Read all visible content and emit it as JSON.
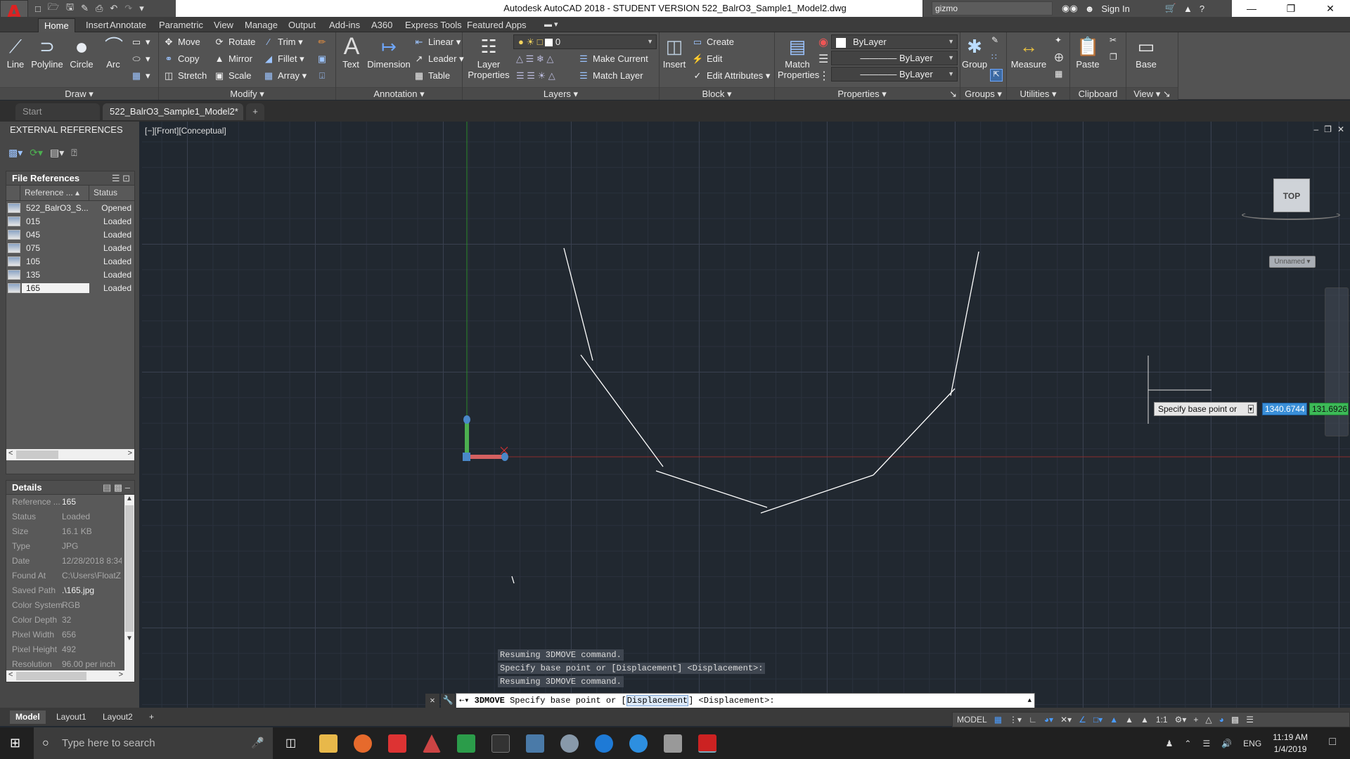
{
  "titlebar": {
    "app_icon": "autocad-logo-icon",
    "app_letter": "A",
    "title": "Autodesk AutoCAD 2018 - STUDENT VERSION    522_BalrO3_Sample1_Model2.dwg",
    "search_value": "gizmo",
    "sign_in": "Sign In",
    "quick_access": [
      "new-icon",
      "open-icon",
      "save-icon",
      "saveas-icon",
      "print-icon",
      "undo-icon",
      "redo-icon",
      "customize-icon"
    ]
  },
  "ribbon_tabs": [
    "Home",
    "Insert",
    "Annotate",
    "Parametric",
    "View",
    "Manage",
    "Output",
    "Add-ins",
    "A360",
    "Express Tools",
    "Featured Apps"
  ],
  "ribbon": {
    "draw": {
      "title": "Draw",
      "line": "Line",
      "polyline": "Polyline",
      "circle": "Circle",
      "arc": "Arc"
    },
    "modify": {
      "title": "Modify",
      "move": "Move",
      "rotate": "Rotate",
      "trim": "Trim",
      "copy": "Copy",
      "mirror": "Mirror",
      "fillet": "Fillet",
      "stretch": "Stretch",
      "scale": "Scale",
      "array": "Array"
    },
    "annotation": {
      "title": "Annotation",
      "text": "Text",
      "dimension": "Dimension",
      "linear": "Linear",
      "leader": "Leader",
      "table": "Table"
    },
    "layers": {
      "title": "Layers",
      "layer_properties": "Layer Properties",
      "current_layer": "0",
      "make_current": "Make Current",
      "match_layer": "Match Layer"
    },
    "block": {
      "title": "Block",
      "insert": "Insert",
      "create": "Create",
      "edit": "Edit",
      "edit_attributes": "Edit Attributes"
    },
    "properties": {
      "title": "Properties",
      "match_properties": "Match Properties",
      "color": "ByLayer",
      "lineweight": "ByLayer",
      "linetype": "ByLayer"
    },
    "groups": {
      "title": "Groups",
      "group": "Group"
    },
    "utilities": {
      "title": "Utilities",
      "measure": "Measure"
    },
    "clipboard": {
      "title": "Clipboard",
      "paste": "Paste"
    },
    "view": {
      "title": "View",
      "base": "Base"
    }
  },
  "doc_tabs": {
    "start": "Start",
    "active": "522_BalrO3_Sample1_Model2*"
  },
  "xref_palette": {
    "title": "EXTERNAL REFERENCES",
    "file_refs_title": "File References",
    "col_reference": "Reference ...",
    "col_status": "Status",
    "rows": [
      {
        "name": "522_BalrO3_S...",
        "status": "Opened"
      },
      {
        "name": "015",
        "status": "Loaded"
      },
      {
        "name": "045",
        "status": "Loaded"
      },
      {
        "name": "075",
        "status": "Loaded"
      },
      {
        "name": "105",
        "status": "Loaded"
      },
      {
        "name": "135",
        "status": "Loaded"
      },
      {
        "name": "165",
        "status": "Loaded"
      }
    ],
    "details_title": "Details",
    "details": [
      {
        "k": "Reference ...",
        "v": "165"
      },
      {
        "k": "Status",
        "v": "Loaded"
      },
      {
        "k": "Size",
        "v": "16.1 KB"
      },
      {
        "k": "Type",
        "v": "JPG"
      },
      {
        "k": "Date",
        "v": "12/28/2018 8:34"
      },
      {
        "k": "Found At",
        "v": "C:\\Users\\FloatZ"
      },
      {
        "k": "Saved Path",
        "v": ".\\165.jpg"
      },
      {
        "k": "Color System",
        "v": "RGB"
      },
      {
        "k": "Color Depth",
        "v": "32"
      },
      {
        "k": "Pixel Width",
        "v": "656"
      },
      {
        "k": "Pixel Height",
        "v": "492"
      },
      {
        "k": "Resolution",
        "v": "96.00 per inch"
      }
    ]
  },
  "viewport": {
    "label": "[−][Front][Conceptual]",
    "viewcube": "TOP",
    "ucs_name": "Unnamed",
    "dynamic_prompt": "Specify base point or",
    "dyn_x": "1340.6744",
    "dyn_y": "131.6926"
  },
  "command": {
    "history": [
      "Resuming 3DMOVE command.",
      "Specify base point or [Displacement] <Displacement>:",
      "Resuming 3DMOVE command."
    ],
    "prompt_cmd": "3DMOVE",
    "prompt_pre": "Specify base point or [",
    "prompt_opt": "Displacement",
    "prompt_post": "] <Displacement>:"
  },
  "layout_tabs": [
    "Model",
    "Layout1",
    "Layout2"
  ],
  "statusbar": {
    "model": "MODEL",
    "scale": "1:1"
  },
  "taskbar": {
    "search_placeholder": "Type here to search",
    "lang": "ENG",
    "time": "11:19 AM",
    "date": "1/4/2019"
  }
}
